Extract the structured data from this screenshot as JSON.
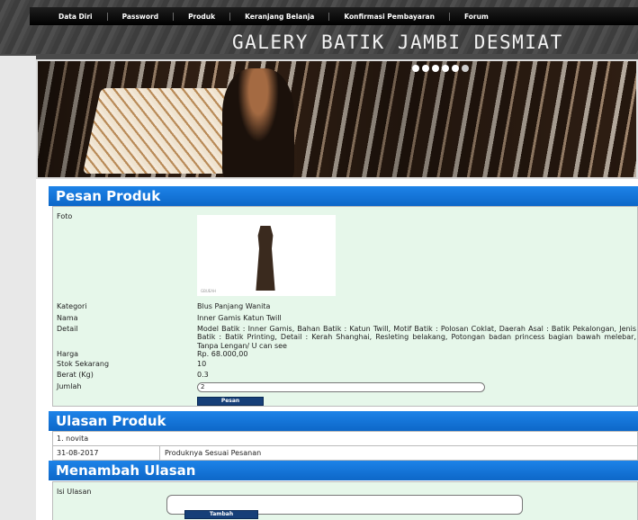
{
  "nav": {
    "items": [
      "Data Diri",
      "Password",
      "Produk",
      "Keranjang Belanja",
      "Konfirmasi Pembayaran",
      "Forum"
    ]
  },
  "site": {
    "title": "GALERY BATIK JAMBI DESMIAT"
  },
  "banner": {
    "slide_count": 6,
    "active_slide": 6
  },
  "order": {
    "heading": "Pesan Produk",
    "foto_label": "Foto",
    "image_caption": "GBUEAH",
    "fields": [
      {
        "label": "Kategori",
        "value": "Blus Panjang Wanita"
      },
      {
        "label": "Nama",
        "value": "Inner Gamis Katun Twill"
      },
      {
        "label": "Detail",
        "value": "Model Batik : Inner Gamis, Bahan Batik : Katun Twill, Motif Batik : Polosan Coklat, Daerah Asal : Batik Pekalongan, Jenis Batik : Batik Printing, Detail : Kerah Shanghai, Resleting belakang, Potongan badan princess bagian bawah melebar, Tanpa Lengan/ U can see"
      },
      {
        "label": "Harga",
        "value": "Rp. 68.000,00"
      },
      {
        "label": "Stok Sekarang",
        "value": "10"
      },
      {
        "label": "Berat (Kg)",
        "value": "0.3"
      }
    ],
    "qty_label": "Jumlah",
    "qty_value": "2",
    "submit_label": "Pesan"
  },
  "reviews": {
    "heading": "Ulasan Produk",
    "items": [
      {
        "author": "1. novita",
        "date": "31-08-2017",
        "text": "Produknya Sesuai Pesanan"
      }
    ]
  },
  "add_review": {
    "heading": "Menambah Ulasan",
    "label": "Isi Ulasan",
    "input_value": "",
    "submit_label": "Tambah"
  },
  "colors": {
    "section_bar": "#0d67c8",
    "form_bg": "#e6f7ea",
    "button": "#163f78",
    "nav_bg": "#000000"
  }
}
